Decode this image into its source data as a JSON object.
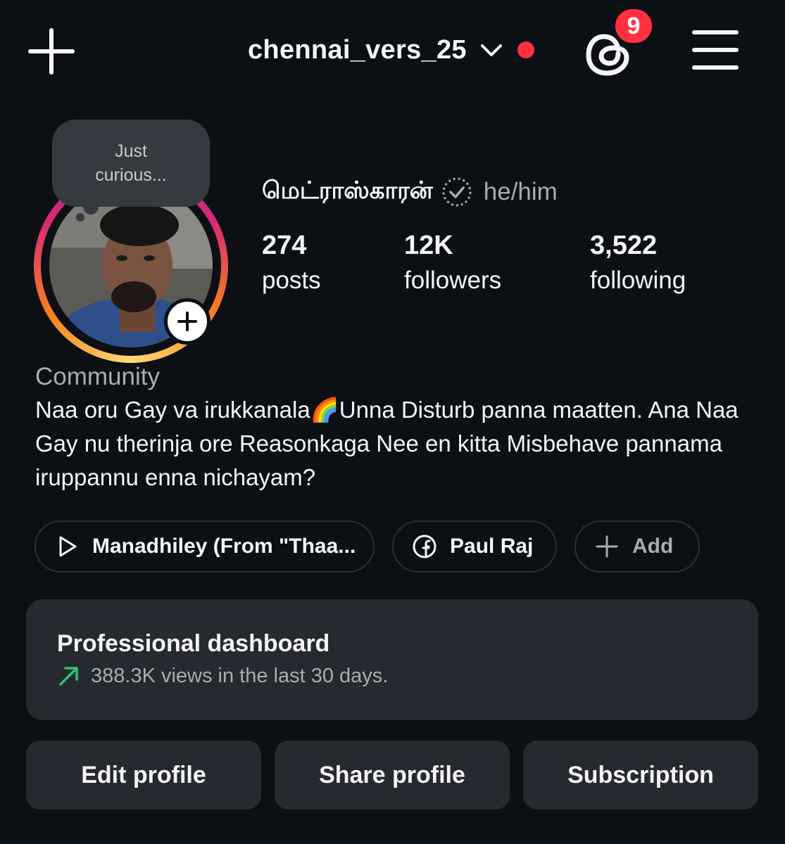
{
  "header": {
    "username": "chennai_vers_25",
    "notification_count": "9",
    "create_icon": "plus-icon",
    "threads_icon": "threads-icon",
    "menu_icon": "hamburger-menu-icon"
  },
  "profile": {
    "note": "Just curious...",
    "display_name": "மெட்ராஸ்காரன்",
    "pronouns": "he/him",
    "stats": [
      {
        "value": "274",
        "label": "posts"
      },
      {
        "value": "12K",
        "label": "followers"
      },
      {
        "value": "3,522",
        "label": "following"
      }
    ],
    "category": "Community",
    "bio": "Naa oru Gay va irukkanala🌈Unna Disturb panna maatten. Ana Naa Gay nu therinja ore Reasonkaga Nee en kitta Misbehave pannama iruppannu enna nichayam?"
  },
  "chips": {
    "music": "Manadhiley (From \"Thaa...",
    "facebook": "Paul Raj",
    "add": "Add"
  },
  "dashboard": {
    "title": "Professional dashboard",
    "subtitle": "388.3K views in the last 30 days."
  },
  "actions": {
    "edit": "Edit profile",
    "share": "Share profile",
    "subscription": "Subscription"
  },
  "colors": {
    "background": "#0c1014",
    "notification_red": "#ff3040",
    "card": "#262a30",
    "trend_green": "#2fc26b"
  }
}
